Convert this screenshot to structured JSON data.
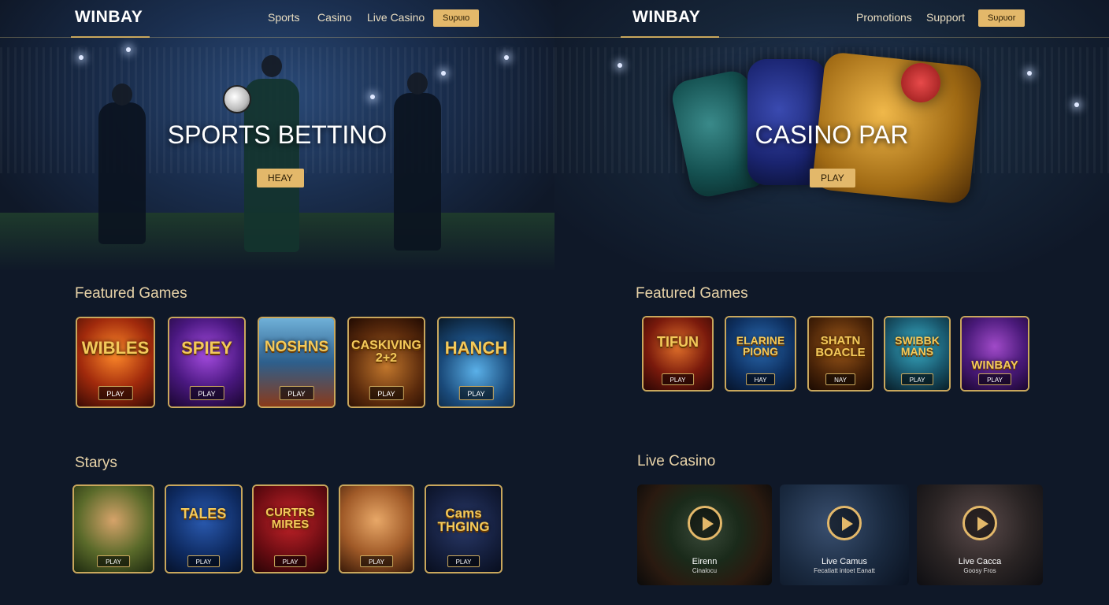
{
  "left": {
    "logo": "WINBAY",
    "nav": [
      "Sports",
      "Casino",
      "Live Casino"
    ],
    "nav_button": "Sυρυιο",
    "hero_title": "SPORTS BETTINO",
    "hero_button": "HEAY",
    "featured_title": "Featured Games",
    "featured": [
      {
        "name": "WIBLES",
        "play": "PLAY"
      },
      {
        "name": "SPIEY",
        "play": "PLAY"
      },
      {
        "name": "NOSHNS",
        "play": "PLAY"
      },
      {
        "name": "CASKIVING 2+2",
        "play": "PLAY"
      },
      {
        "name": "HANCH",
        "play": "PLAY"
      }
    ],
    "second_title": "Starys",
    "second": [
      {
        "name": "",
        "play": "PLAY"
      },
      {
        "name": "TALES",
        "play": "PLAY"
      },
      {
        "name": "CURTRS MIRES",
        "play": "PLAY"
      },
      {
        "name": "",
        "play": "PLAY"
      },
      {
        "name": "Cams THGING",
        "play": "PLAY"
      }
    ]
  },
  "right": {
    "logo": "WINBAY",
    "nav": [
      "Promotions",
      "Support"
    ],
    "nav_button": "Sυρυοr",
    "hero_title": "CASINO PAR",
    "hero_button": "PLAY",
    "featured_title": "Featured Games",
    "featured": [
      {
        "name": "TIFUN",
        "play": "PLAY"
      },
      {
        "name": "ELARINE PIONG",
        "play": "HAY"
      },
      {
        "name": "SHATN BOACLE",
        "play": "NAY"
      },
      {
        "name": "SWIBBK MANS",
        "play": "PLAY"
      },
      {
        "name": "WINBAY",
        "play": "PLAY"
      }
    ],
    "live_title": "Live Casino",
    "live": [
      {
        "title": "Eirenn",
        "sub": "Cinalocu"
      },
      {
        "title": "Live Camus",
        "sub": "Fecatiatt intoet Eanatt"
      },
      {
        "title": "Live Cacca",
        "sub": "Goosy Fros"
      }
    ]
  }
}
